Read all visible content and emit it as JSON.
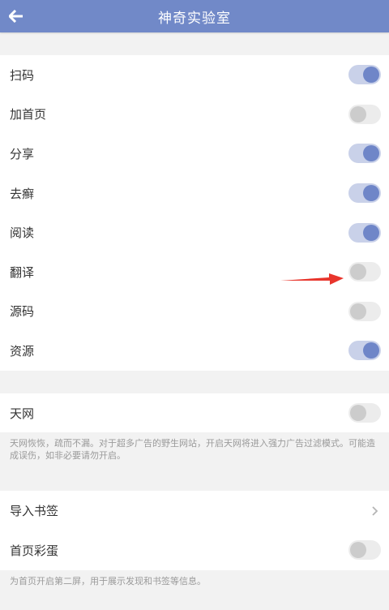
{
  "appbar": {
    "title": "神奇实验室",
    "back_icon": "arrow-left-icon",
    "background": "#7189c8"
  },
  "toggles": [
    {
      "key": "scan",
      "label": "扫码",
      "on": true
    },
    {
      "key": "add-home",
      "label": "加首页",
      "on": false
    },
    {
      "key": "share",
      "label": "分享",
      "on": true
    },
    {
      "key": "remove-ads",
      "label": "去癣",
      "on": true
    },
    {
      "key": "read",
      "label": "阅读",
      "on": true
    },
    {
      "key": "translate",
      "label": "翻译",
      "on": false
    },
    {
      "key": "source",
      "label": "源码",
      "on": false
    },
    {
      "key": "resources",
      "label": "资源",
      "on": true
    }
  ],
  "tianwang": {
    "label": "天网",
    "on": false,
    "note": "天网恢恢，疏而不漏。对于超多广告的野生网站，开启天网将进入强力广告过滤模式。可能造成误伤，如非必要请勿开启。"
  },
  "bookmarks": {
    "import_label": "导入书签",
    "import_icon": "chevron-right-icon"
  },
  "egg": {
    "label": "首页彩蛋",
    "on": false,
    "note": "为首页开启第二屏，用于展示发现和书签等信息。"
  },
  "annotation": {
    "icon": "red-arrow-icon",
    "color": "#e8352c",
    "points_to": "translate"
  },
  "colors": {
    "accent": "#6f86c8",
    "track_on": "#c9d1e9",
    "track_off": "#ececec",
    "knob_off": "#cccccc"
  }
}
